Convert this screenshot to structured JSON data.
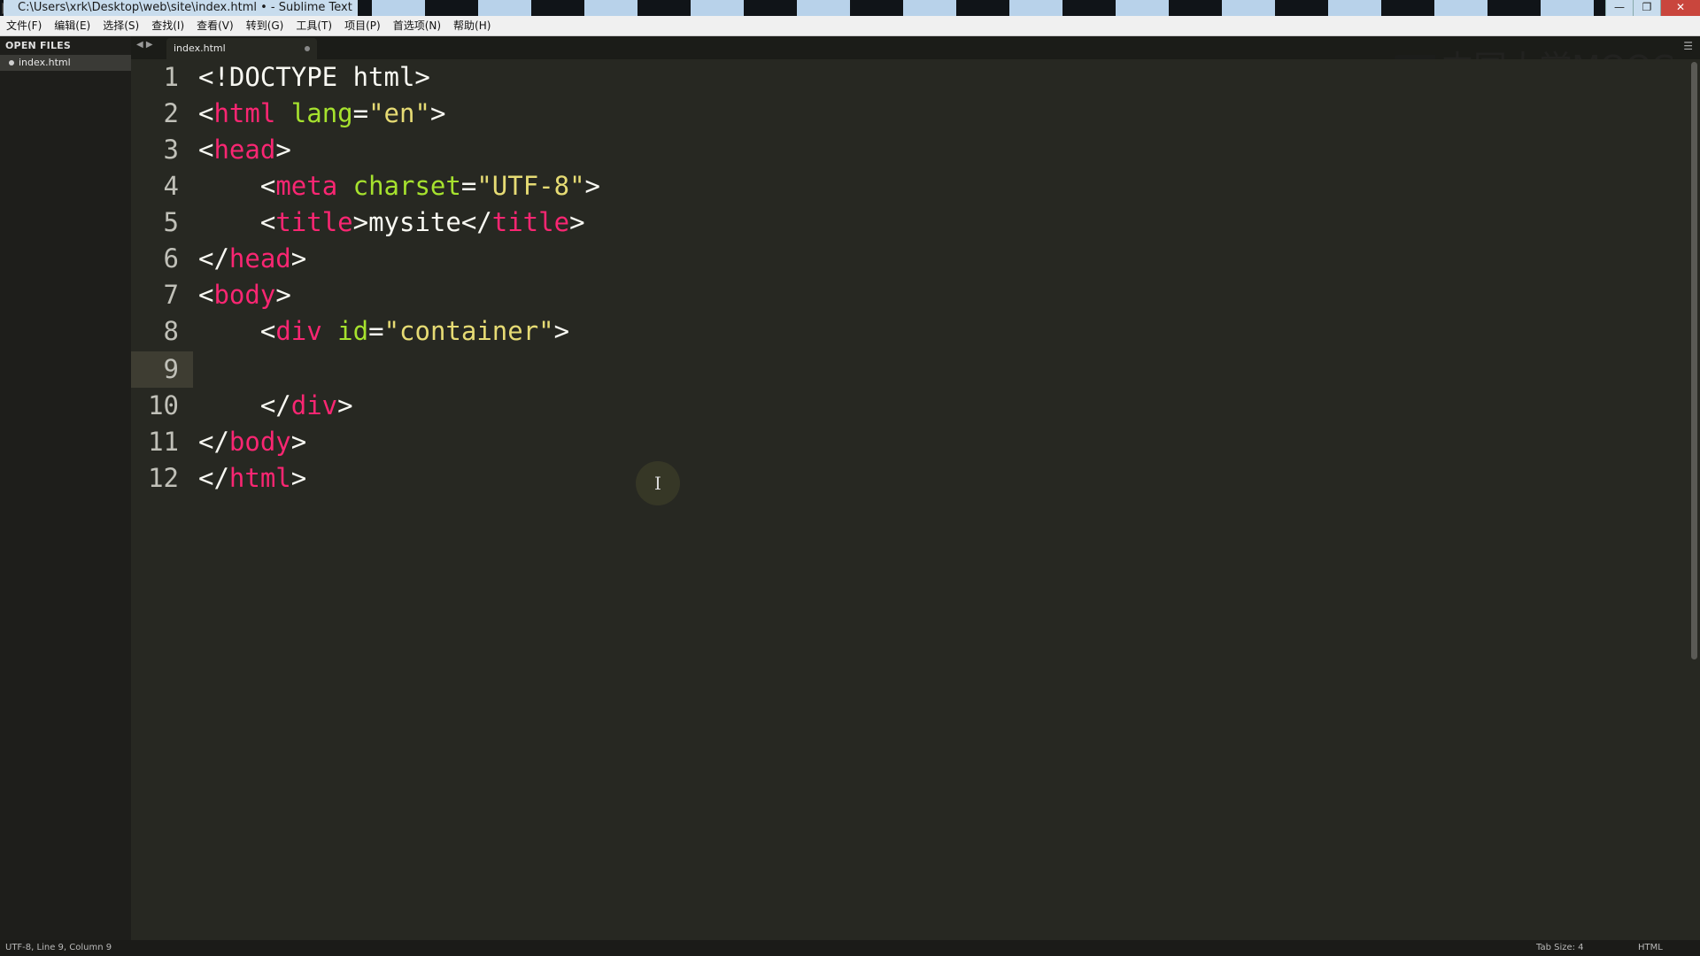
{
  "window": {
    "title": "C:\\Users\\xrk\\Desktop\\web\\site\\index.html • - Sublime Text",
    "buttons": {
      "minimize": "—",
      "maximize": "❐",
      "close": "✕"
    }
  },
  "menubar": {
    "items": [
      "文件(F)",
      "编辑(E)",
      "选择(S)",
      "查找(I)",
      "查看(V)",
      "转到(G)",
      "工具(T)",
      "项目(P)",
      "首选项(N)",
      "帮助(H)"
    ]
  },
  "sidebar": {
    "header": "OPEN FILES",
    "files": [
      {
        "name": "index.html"
      }
    ]
  },
  "tabs": [
    {
      "label": "index.html",
      "modified": true
    }
  ],
  "watermark": "中国大学MOOC",
  "editor": {
    "current_line": 9,
    "line_numbers": [
      "1",
      "2",
      "3",
      "4",
      "5",
      "6",
      "7",
      "8",
      "9",
      "10",
      "11",
      "12"
    ]
  },
  "statusbar": {
    "position": "UTF-8, Line 9, Column 9",
    "tab_size": "Tab Size: 4",
    "syntax": "HTML"
  },
  "colors": {
    "background": "#272822",
    "tag": "#f92672",
    "attribute": "#a6e22e",
    "string": "#e6db74",
    "text": "#f8f8f2"
  }
}
